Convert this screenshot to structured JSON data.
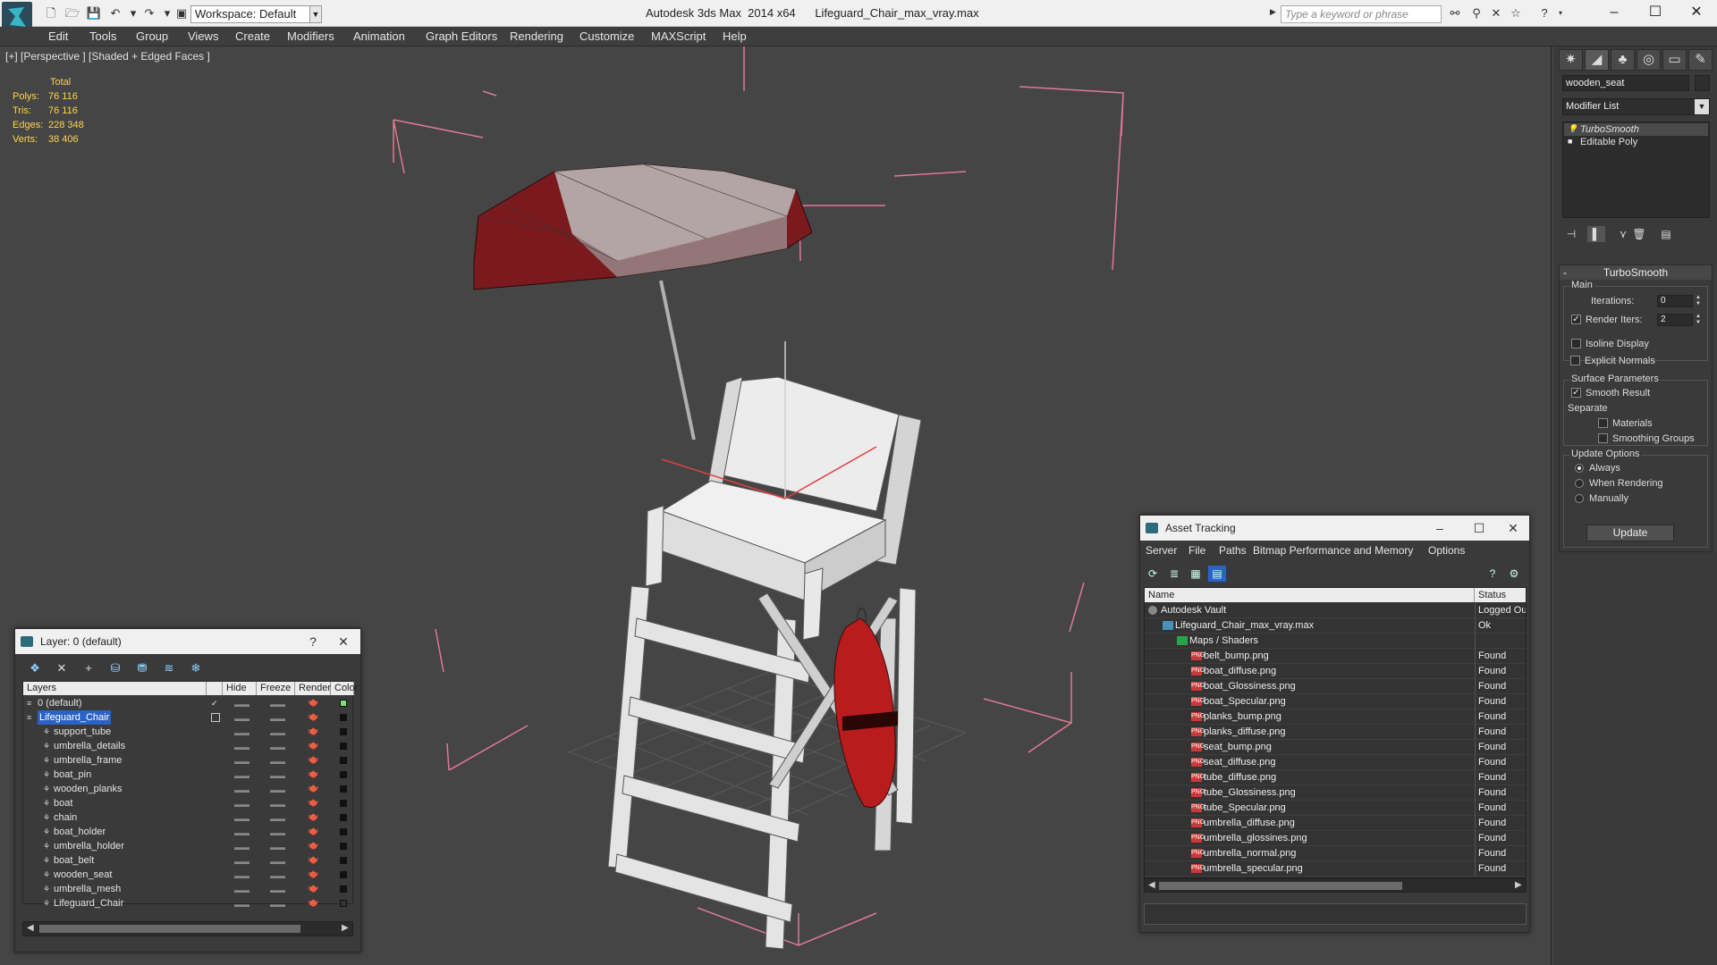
{
  "titlebar": {
    "workspace": "Workspace: Default",
    "title": "Autodesk 3ds Max  2014 x64      Lifeguard_Chair_max_vray.max",
    "search_placeholder": "Type a keyword or phrase"
  },
  "menu": [
    "Edit",
    "Tools",
    "Group",
    "Views",
    "Create",
    "Modifiers",
    "Animation",
    "Graph Editors",
    "Rendering",
    "Customize",
    "MAXScript",
    "Help"
  ],
  "viewport": {
    "label": "[+] [Perspective ] [Shaded + Edged Faces ]",
    "stats": {
      "header": "Total",
      "polys_label": "Polys:",
      "polys": "76 116",
      "tris_label": "Tris:",
      "tris": "76 116",
      "edges_label": "Edges:",
      "edges": "228 348",
      "verts_label": "Verts:",
      "verts": "38 406"
    },
    "colors": {
      "bounding_box": "#e07896",
      "umbrella": "#8a1c22",
      "wood": "#e6e6e6",
      "buoy": "#b81c1c"
    }
  },
  "command_panel": {
    "object_name": "wooden_seat",
    "modifier_list": "Modifier List",
    "stack": [
      "TurboSmooth",
      "Editable Poly"
    ],
    "rollout_title": "TurboSmooth",
    "main_group": "Main",
    "iterations_label": "Iterations:",
    "iterations": "0",
    "render_iters_label": "Render Iters:",
    "render_iters": "2",
    "render_iters_checked": true,
    "isoline": "Isoline Display",
    "explicit_normals": "Explicit Normals",
    "surface_group": "Surface Parameters",
    "smooth_result": "Smooth Result",
    "separate": "Separate",
    "materials": "Materials",
    "smoothing_groups": "Smoothing Groups",
    "update_group": "Update Options",
    "always": "Always",
    "when_rendering": "When Rendering",
    "manually": "Manually",
    "update_button": "Update"
  },
  "layer_window": {
    "title": "Layer: 0 (default)",
    "columns": [
      "Layers",
      "Hide",
      "Freeze",
      "Render",
      "Color"
    ],
    "rows": [
      {
        "name": "0 (default)",
        "level": 0,
        "type": "layer",
        "color": "#7be07b",
        "current": true
      },
      {
        "name": "Lifeguard_Chair",
        "level": 0,
        "type": "layer",
        "color": "#111111",
        "selected": true
      },
      {
        "name": "support_tube",
        "level": 1,
        "type": "object",
        "color": "#111111"
      },
      {
        "name": "umbrella_details",
        "level": 1,
        "type": "object",
        "color": "#111111"
      },
      {
        "name": "umbrella_frame",
        "level": 1,
        "type": "object",
        "color": "#111111"
      },
      {
        "name": "boat_pin",
        "level": 1,
        "type": "object",
        "color": "#111111"
      },
      {
        "name": "wooden_planks",
        "level": 1,
        "type": "object",
        "color": "#111111"
      },
      {
        "name": "boat",
        "level": 1,
        "type": "object",
        "color": "#111111"
      },
      {
        "name": "chain",
        "level": 1,
        "type": "object",
        "color": "#111111"
      },
      {
        "name": "boat_holder",
        "level": 1,
        "type": "object",
        "color": "#111111"
      },
      {
        "name": "umbrella_holder",
        "level": 1,
        "type": "object",
        "color": "#111111"
      },
      {
        "name": "boat_belt",
        "level": 1,
        "type": "object",
        "color": "#111111"
      },
      {
        "name": "wooden_seat",
        "level": 1,
        "type": "object",
        "color": "#111111"
      },
      {
        "name": "umbrella_mesh",
        "level": 1,
        "type": "object",
        "color": "#111111"
      },
      {
        "name": "Lifeguard_Chair",
        "level": 1,
        "type": "object",
        "color": "#333333"
      }
    ]
  },
  "asset_window": {
    "title": "Asset Tracking",
    "menu": [
      "Server",
      "File",
      "Paths",
      "Bitmap Performance and Memory",
      "Options"
    ],
    "columns": [
      "Name",
      "Status"
    ],
    "rows": [
      {
        "name": "Autodesk Vault",
        "status": "Logged Ou",
        "level": 0,
        "icon": "vault"
      },
      {
        "name": "Lifeguard_Chair_max_vray.max",
        "status": "Ok",
        "level": 1,
        "icon": "max"
      },
      {
        "name": "Maps / Shaders",
        "status": "",
        "level": 2,
        "icon": "maps"
      },
      {
        "name": "belt_bump.png",
        "status": "Found",
        "level": 3,
        "icon": "png"
      },
      {
        "name": "boat_diffuse.png",
        "status": "Found",
        "level": 3,
        "icon": "png"
      },
      {
        "name": "boat_Glossiness.png",
        "status": "Found",
        "level": 3,
        "icon": "png"
      },
      {
        "name": "boat_Specular.png",
        "status": "Found",
        "level": 3,
        "icon": "png"
      },
      {
        "name": "planks_bump.png",
        "status": "Found",
        "level": 3,
        "icon": "png"
      },
      {
        "name": "planks_diffuse.png",
        "status": "Found",
        "level": 3,
        "icon": "png"
      },
      {
        "name": "seat_bump.png",
        "status": "Found",
        "level": 3,
        "icon": "png"
      },
      {
        "name": "seat_diffuse.png",
        "status": "Found",
        "level": 3,
        "icon": "png"
      },
      {
        "name": "tube_diffuse.png",
        "status": "Found",
        "level": 3,
        "icon": "png"
      },
      {
        "name": "tube_Glossiness.png",
        "status": "Found",
        "level": 3,
        "icon": "png"
      },
      {
        "name": "tube_Specular.png",
        "status": "Found",
        "level": 3,
        "icon": "png"
      },
      {
        "name": "umbrella_diffuse.png",
        "status": "Found",
        "level": 3,
        "icon": "png"
      },
      {
        "name": "umbrella_glossines.png",
        "status": "Found",
        "level": 3,
        "icon": "png"
      },
      {
        "name": "umbrella_normal.png",
        "status": "Found",
        "level": 3,
        "icon": "png"
      },
      {
        "name": "umbrella_specular.png",
        "status": "Found",
        "level": 3,
        "icon": "png"
      }
    ]
  }
}
